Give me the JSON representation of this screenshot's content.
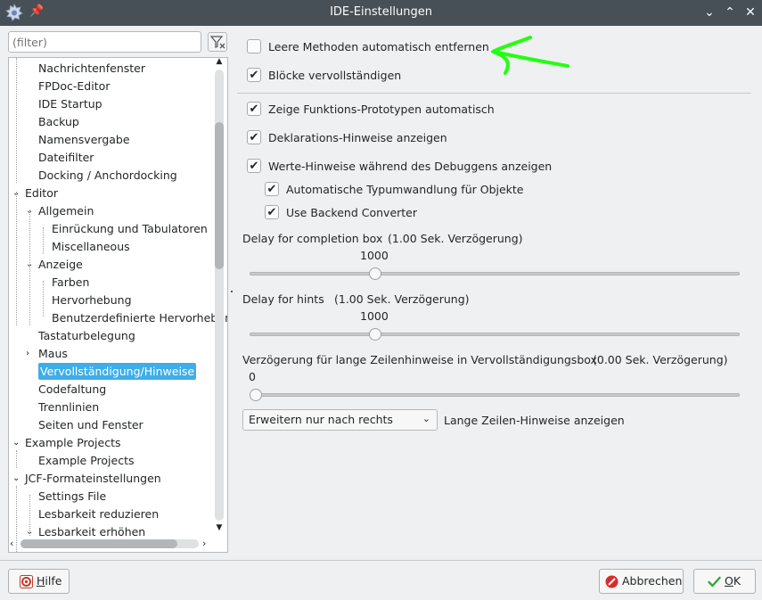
{
  "window": {
    "title": "IDE-Einstellungen"
  },
  "filter": {
    "placeholder": "(filter)"
  },
  "tree": {
    "items": [
      {
        "label": "Nachrichtenfenster",
        "level": 1
      },
      {
        "label": "FPDoc-Editor",
        "level": 1
      },
      {
        "label": "IDE Startup",
        "level": 1
      },
      {
        "label": "Backup",
        "level": 1
      },
      {
        "label": "Namensvergabe",
        "level": 1
      },
      {
        "label": "Dateifilter",
        "level": 1
      },
      {
        "label": "Docking / Anchordocking",
        "level": 1
      },
      {
        "label": "Editor",
        "level": 0,
        "expanded": true
      },
      {
        "label": "Allgemein",
        "level": 1,
        "expanded": true
      },
      {
        "label": "Einrückung und Tabulatoren",
        "level": 2
      },
      {
        "label": "Miscellaneous",
        "level": 2
      },
      {
        "label": "Anzeige",
        "level": 1,
        "expanded": true
      },
      {
        "label": "Farben",
        "level": 2
      },
      {
        "label": "Hervorhebung",
        "level": 2
      },
      {
        "label": "Benutzerdefinierte Hervorhebungen",
        "level": 2
      },
      {
        "label": "Tastaturbelegung",
        "level": 1
      },
      {
        "label": "Maus",
        "level": 1,
        "collapsed": true
      },
      {
        "label": "Vervollständigung/Hinweise",
        "level": 1,
        "selected": true
      },
      {
        "label": "Codefaltung",
        "level": 1
      },
      {
        "label": "Trennlinien",
        "level": 1
      },
      {
        "label": "Seiten und Fenster",
        "level": 1
      },
      {
        "label": "Example Projects",
        "level": 0,
        "expanded": true
      },
      {
        "label": "Example Projects",
        "level": 1
      },
      {
        "label": "JCF-Formateinstellungen",
        "level": 0,
        "expanded": true
      },
      {
        "label": "Settings File",
        "level": 1
      },
      {
        "label": "Lesbarkeit reduzieren",
        "level": 1
      },
      {
        "label": "Lesbarkeit erhöhen",
        "level": 1,
        "expanded": true
      }
    ]
  },
  "options": {
    "remove_empty_methods": {
      "label": "Leere Methoden automatisch entfernen",
      "checked": false
    },
    "complete_blocks": {
      "label": "Blöcke vervollständigen",
      "checked": true
    },
    "show_prototypes": {
      "label": "Zeige Funktions-Prototypen automatisch",
      "checked": true
    },
    "declaration_hints": {
      "label": "Deklarations-Hinweise anzeigen",
      "checked": true
    },
    "value_hints": {
      "label": "Werte-Hinweise während des Debuggens anzeigen",
      "checked": true
    },
    "auto_typecast": {
      "label": "Automatische Typumwandlung für Objekte",
      "checked": true
    },
    "backend_converter": {
      "label": "Use Backend Converter",
      "checked": true
    }
  },
  "sliders": [
    {
      "label": "Delay for completion box",
      "note": "(1.00 Sek. Verzögerung)",
      "value_text": "1000",
      "fraction": 0.25
    },
    {
      "label": "Delay for hints",
      "note": "(1.00 Sek. Verzögerung)",
      "value_text": "1000",
      "fraction": 0.25
    },
    {
      "label": "Verzögerung für lange Zeilenhinweise in Vervollständigungsbox",
      "note": "(0.00 Sek. Verzögerung)",
      "value_text": "0",
      "fraction": 0.0
    }
  ],
  "long_line": {
    "combo_value": "Erweitern nur nach rechts",
    "label": "Lange Zeilen-Hinweise anzeigen"
  },
  "buttons": {
    "help": {
      "mnemonic": "H",
      "rest": "ilfe"
    },
    "cancel": {
      "label": "Abbrechen"
    },
    "ok": {
      "mnemonic": "O",
      "rest": "K"
    }
  },
  "colors": {
    "accent": "#3daee9",
    "titlebar": "#475057",
    "annotation_arrow": "#22ff11"
  }
}
